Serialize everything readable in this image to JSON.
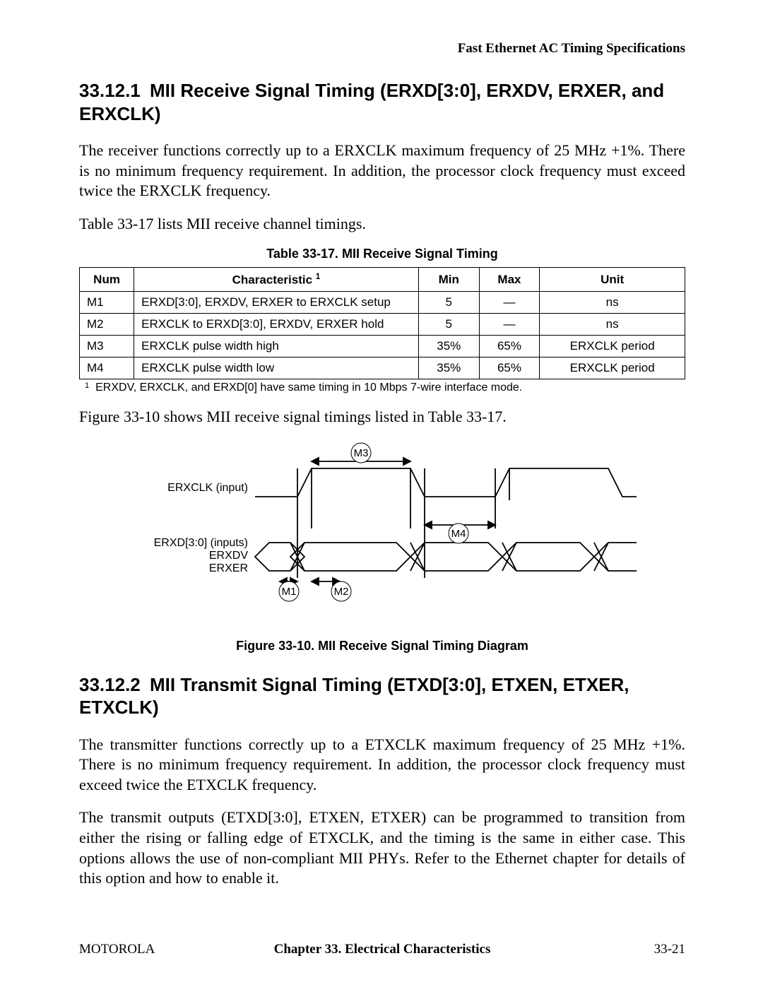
{
  "header": {
    "running_head": "Fast Ethernet AC Timing Specifications"
  },
  "section1": {
    "num": "33.12.1",
    "title": "MII Receive Signal Timing (ERXD[3:0], ERXDV, ERXER, and ERXCLK)",
    "para1": "The receiver functions correctly up to a ERXCLK maximum frequency of 25 MHz +1%. There is no minimum frequency requirement. In addition, the processor clock frequency must exceed twice the ERXCLK frequency.",
    "para2": "Table 33-17 lists MII receive channel timings."
  },
  "table17": {
    "caption": "Table 33-17. MII Receive Signal Timing",
    "headers": {
      "num": "Num",
      "char": "Characteristic",
      "char_sup": "1",
      "min": "Min",
      "max": "Max",
      "unit": "Unit"
    },
    "rows": [
      {
        "num": "M1",
        "char": "ERXD[3:0], ERXDV, ERXER to ERXCLK setup",
        "min": "5",
        "max": "—",
        "unit": "ns"
      },
      {
        "num": "M2",
        "char": "ERXCLK to ERXD[3:0], ERXDV, ERXER hold",
        "min": "5",
        "max": "—",
        "unit": "ns"
      },
      {
        "num": "M3",
        "char": "ERXCLK pulse width high",
        "min": "35%",
        "max": "65%",
        "unit": "ERXCLK period"
      },
      {
        "num": "M4",
        "char": "ERXCLK pulse width low",
        "min": "35%",
        "max": "65%",
        "unit": "ERXCLK period"
      }
    ],
    "footnote_sup": "1",
    "footnote": "ERXDV, ERXCLK, and ERXD[0] have same timing in 10 Mbps 7-wire interface mode."
  },
  "post_table_para": "Figure 33-10 shows MII receive signal timings listed in Table 33-17.",
  "figure10": {
    "caption": "Figure 33-10. MII Receive Signal Timing Diagram",
    "labels": {
      "clk": "ERXCLK (input)",
      "data1": "ERXD[3:0] (inputs)",
      "data2": "ERXDV",
      "data3": "ERXER",
      "m1": "M1",
      "m2": "M2",
      "m3": "M3",
      "m4": "M4"
    }
  },
  "section2": {
    "num": "33.12.2",
    "title": "MII Transmit Signal Timing (ETXD[3:0], ETXEN, ETXER, ETXCLK)",
    "para1": "The transmitter functions correctly up to a ETXCLK maximum frequency of 25 MHz +1%. There is no minimum frequency requirement. In addition, the processor clock frequency must exceed twice the ETXCLK frequency.",
    "para2": "The transmit outputs (ETXD[3:0], ETXEN, ETXER) can be programmed to transition from either the rising or falling edge of ETXCLK, and the timing is the same in either case. This options allows the use of non-compliant MII PHYs. Refer to the Ethernet chapter for details of this option and how to enable it."
  },
  "footer": {
    "left": "MOTOROLA",
    "center": "Chapter 33.  Electrical Characteristics",
    "right": "33-21"
  }
}
